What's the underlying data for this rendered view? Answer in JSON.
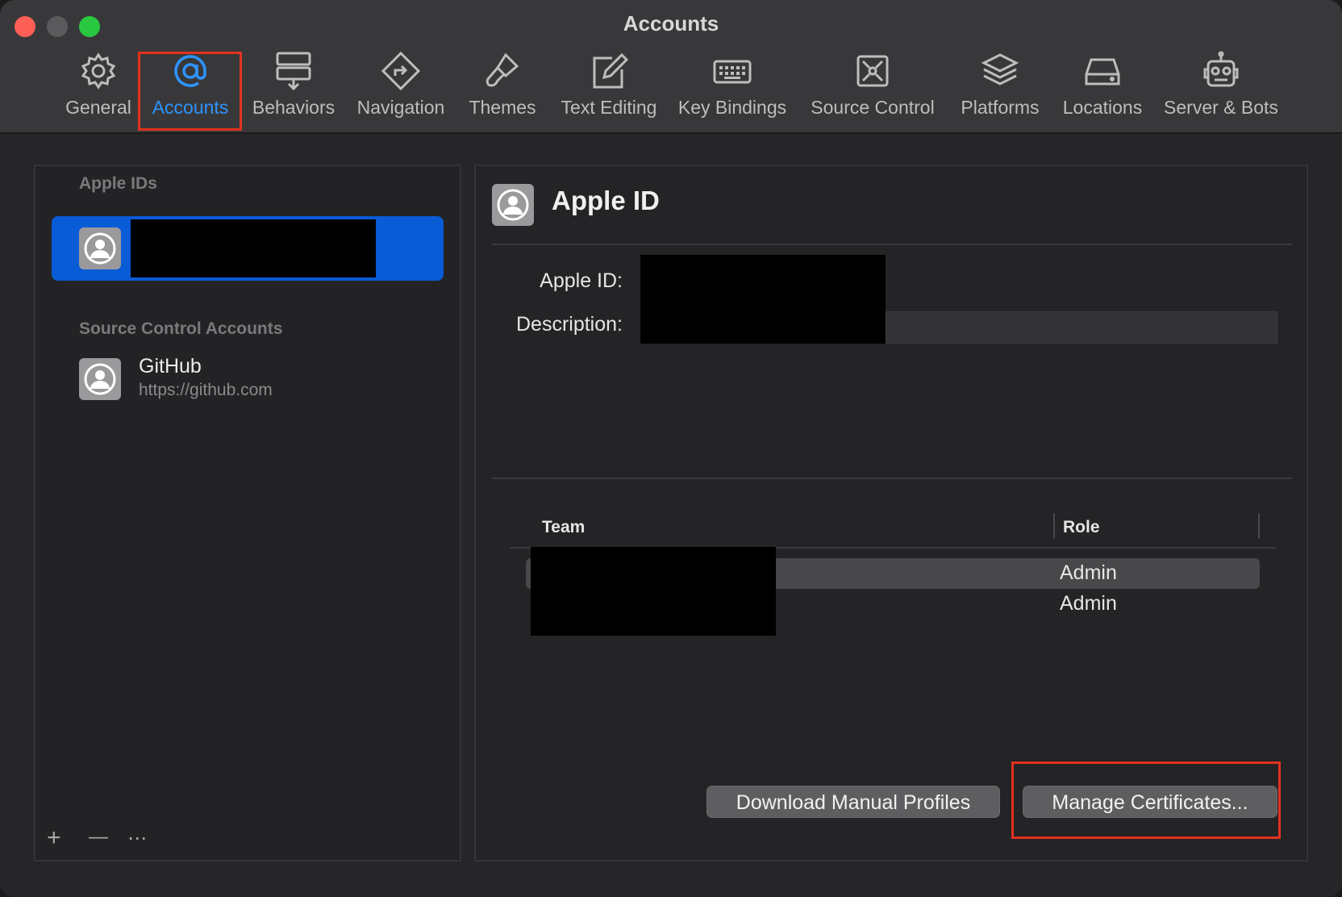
{
  "window": {
    "title": "Accounts"
  },
  "toolbar": {
    "items": [
      {
        "label": "General",
        "icon": "gear-icon"
      },
      {
        "label": "Accounts",
        "icon": "at-sign-icon"
      },
      {
        "label": "Behaviors",
        "icon": "behaviors-icon"
      },
      {
        "label": "Navigation",
        "icon": "navigation-icon"
      },
      {
        "label": "Themes",
        "icon": "paintbrush-icon"
      },
      {
        "label": "Text Editing",
        "icon": "pencil-square-icon"
      },
      {
        "label": "Key Bindings",
        "icon": "keyboard-icon"
      },
      {
        "label": "Source Control",
        "icon": "source-control-icon"
      },
      {
        "label": "Platforms",
        "icon": "layers-icon"
      },
      {
        "label": "Locations",
        "icon": "drive-icon"
      },
      {
        "label": "Server & Bots",
        "icon": "robot-icon"
      }
    ],
    "active": "Accounts"
  },
  "sidebar": {
    "apple_ids_label": "Apple IDs",
    "source_control_label": "Source Control Accounts",
    "source_control_accounts": [
      {
        "name": "GitHub",
        "url": "https://github.com"
      }
    ],
    "footer": {
      "add": "+",
      "remove": "—",
      "more": "⋯"
    }
  },
  "detail": {
    "title": "Apple ID",
    "apple_id_label": "Apple ID:",
    "description_label": "Description:",
    "table": {
      "headers": {
        "team": "Team",
        "role": "Role"
      },
      "rows": [
        {
          "role": "Admin"
        },
        {
          "role": "Admin"
        }
      ]
    },
    "buttons": {
      "download": "Download Manual Profiles",
      "manage": "Manage Certificates..."
    }
  },
  "colors": {
    "accent": "#2e94ff",
    "selection": "#0a5bd6",
    "highlight_box": "#e2321f"
  }
}
